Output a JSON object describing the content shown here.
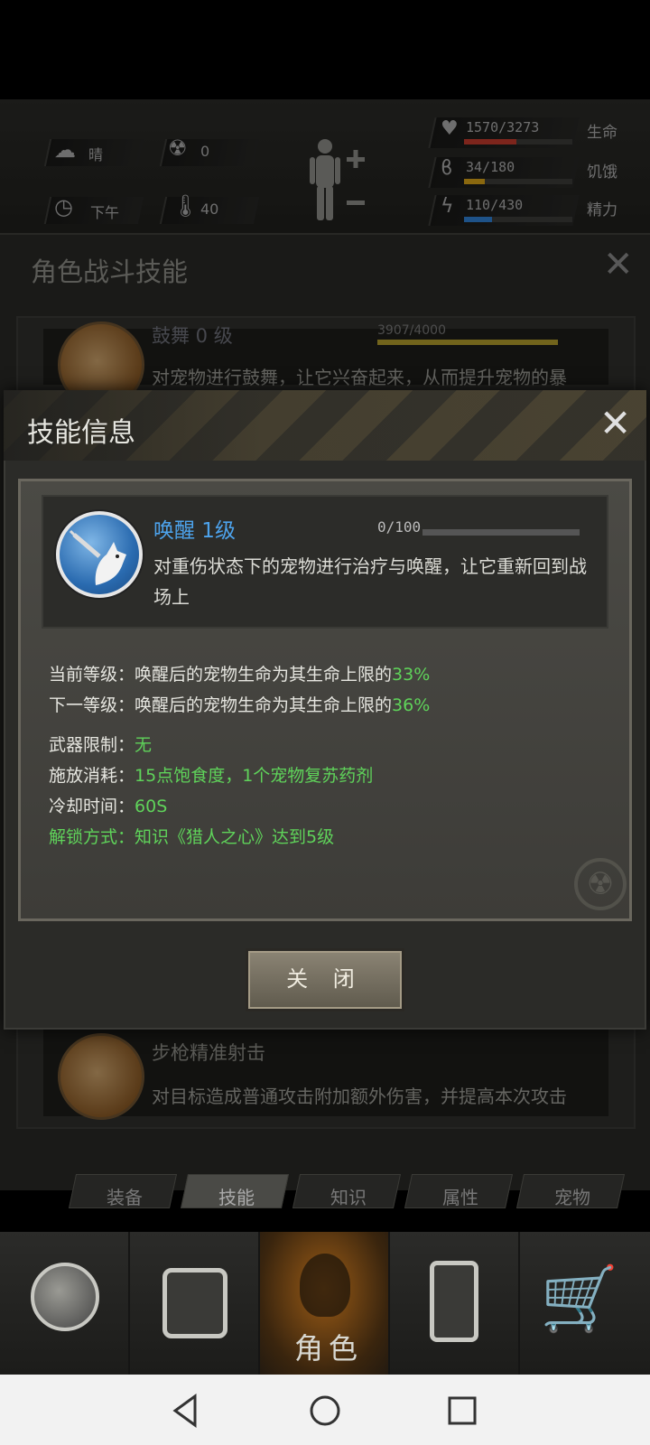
{
  "hud": {
    "weather": "晴",
    "radiation": "0",
    "time_of_day": "下午",
    "temperature": "40",
    "health": {
      "value": "1570/3273",
      "label": "生命",
      "fraction": 0.48,
      "color": "#c0392b"
    },
    "hunger": {
      "value": "34/180",
      "label": "饥饿",
      "fraction": 0.19,
      "color": "#d4a017"
    },
    "energy": {
      "value": "110/430",
      "label": "精力",
      "fraction": 0.26,
      "color": "#2f7fd1"
    },
    "icons": [
      "cloud-sun-icon",
      "radiation-icon",
      "clock-icon",
      "thermometer-icon",
      "body-plus-minus-icon",
      "heart-icon",
      "stomach-icon",
      "lightning-icon"
    ]
  },
  "under_panel": {
    "title": "角色战斗技能",
    "skills": [
      {
        "name": "鼓舞 0 级",
        "desc": "对宠物进行鼓舞，让它兴奋起来，从而提升宠物的暴",
        "progress": "3907/4000"
      },
      {
        "name": "步枪精准射击",
        "desc": "对目标造成普通攻击附加额外伤害，并提高本次攻击"
      }
    ]
  },
  "dialog": {
    "title": "技能信息",
    "skill": {
      "name": "唤醒 1级",
      "progress": "0/100",
      "description": "对重伤状态下的宠物进行治疗与唤醒，让它重新回到战场上"
    },
    "current_level": {
      "label": "当前等级：唤醒后的宠物生命为其生命上限的",
      "value": "33%"
    },
    "next_level": {
      "label": "下一等级：唤醒后的宠物生命为其生命上限的",
      "value": "36%"
    },
    "weapon_limit": {
      "label": "武器限制：",
      "value": "无"
    },
    "cost": {
      "label": "施放消耗：",
      "value": "15点饱食度，1个宠物复苏药剂"
    },
    "cooldown": {
      "label": "冷却时间：",
      "value": "60S"
    },
    "unlock": {
      "label": "解锁方式：",
      "value": "知识《猎人之心》达到5级"
    },
    "close_button": "关 闭"
  },
  "tabs": [
    "装备",
    "技能",
    "知识",
    "属性",
    "宠物"
  ],
  "active_tab": "技能",
  "bottom_nav": {
    "items": [
      "globe-icon",
      "backpack-icon",
      "character-icon",
      "walkie-talkie-icon",
      "shopping-cart-icon"
    ],
    "active_label": "角色"
  },
  "colors": {
    "accent_blue": "#4da3ec",
    "green_value": "#5fd35a"
  }
}
